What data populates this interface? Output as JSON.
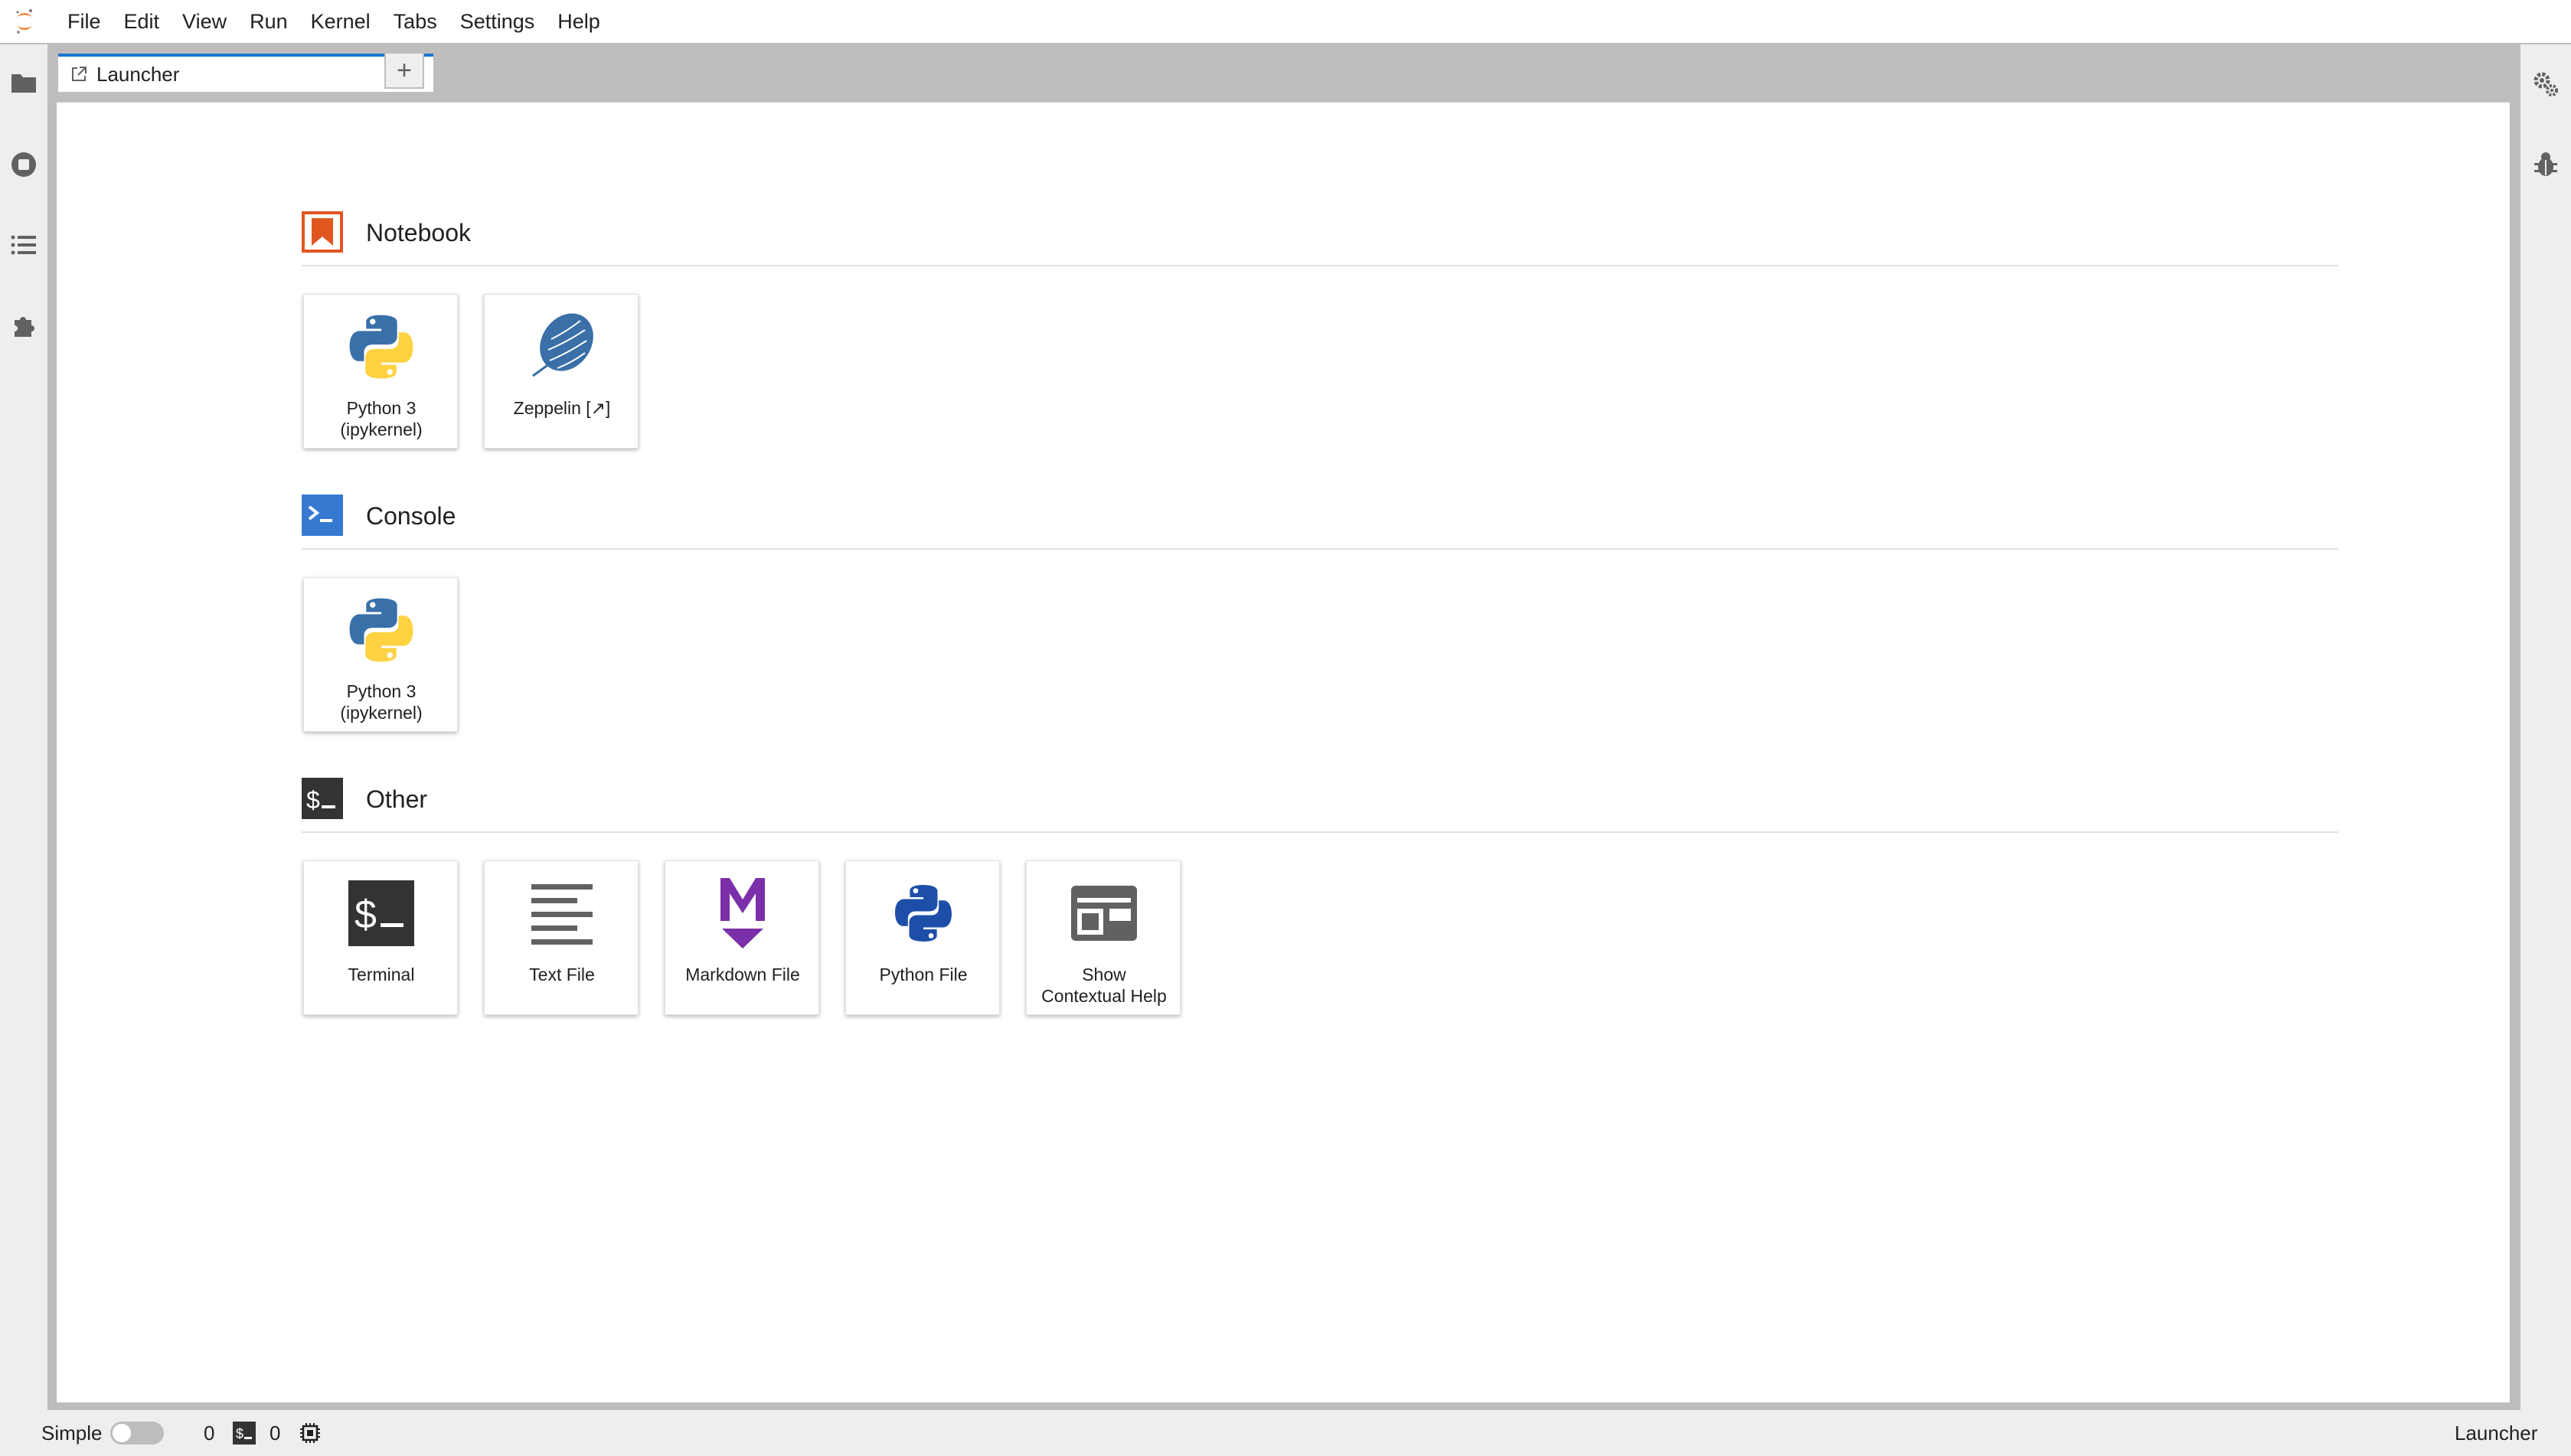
{
  "menubar": {
    "items": [
      "File",
      "Edit",
      "View",
      "Run",
      "Kernel",
      "Tabs",
      "Settings",
      "Help"
    ]
  },
  "left_sidebar": {
    "icons": [
      "folder-icon",
      "running-sessions-icon",
      "table-of-contents-icon",
      "extension-manager-icon"
    ]
  },
  "right_sidebar": {
    "icons": [
      "property-inspector-icon",
      "debugger-icon"
    ]
  },
  "tabs": {
    "active_label": "Launcher",
    "add_label": "+"
  },
  "launcher": {
    "sections": [
      {
        "title": "Notebook",
        "cards": [
          {
            "label": "Python 3 (ipykernel)",
            "line1": "Python 3",
            "line2": "(ipykernel)",
            "icon": "python-icon"
          },
          {
            "label": "Zeppelin [↗]",
            "line1": "Zeppelin [↗]",
            "line2": "",
            "icon": "zeppelin-icon"
          }
        ]
      },
      {
        "title": "Console",
        "cards": [
          {
            "label": "Python 3 (ipykernel)",
            "line1": "Python 3",
            "line2": "(ipykernel)",
            "icon": "python-icon"
          }
        ]
      },
      {
        "title": "Other",
        "cards": [
          {
            "label": "Terminal",
            "line1": "Terminal",
            "line2": "",
            "icon": "terminal-icon"
          },
          {
            "label": "Text File",
            "line1": "Text File",
            "line2": "",
            "icon": "text-file-icon"
          },
          {
            "label": "Markdown File",
            "line1": "Markdown File",
            "line2": "",
            "icon": "markdown-icon"
          },
          {
            "label": "Python File",
            "line1": "Python File",
            "line2": "",
            "icon": "python-file-icon"
          },
          {
            "label": "Show Contextual Help",
            "line1": "Show",
            "line2": "Contextual Help",
            "icon": "contextual-help-icon"
          }
        ]
      }
    ]
  },
  "statusbar": {
    "mode_label": "Simple",
    "kernels_count": "0",
    "terminals_count": "0",
    "right_label": "Launcher"
  },
  "colors": {
    "accent": "#1976d2",
    "notebook_orange": "#e0561f",
    "console_blue": "#3579d1",
    "terminal_dark": "#333333",
    "markdown_purple": "#7b2fa8",
    "python_blue": "#3a70a8",
    "python_yellow": "#ffd242"
  }
}
